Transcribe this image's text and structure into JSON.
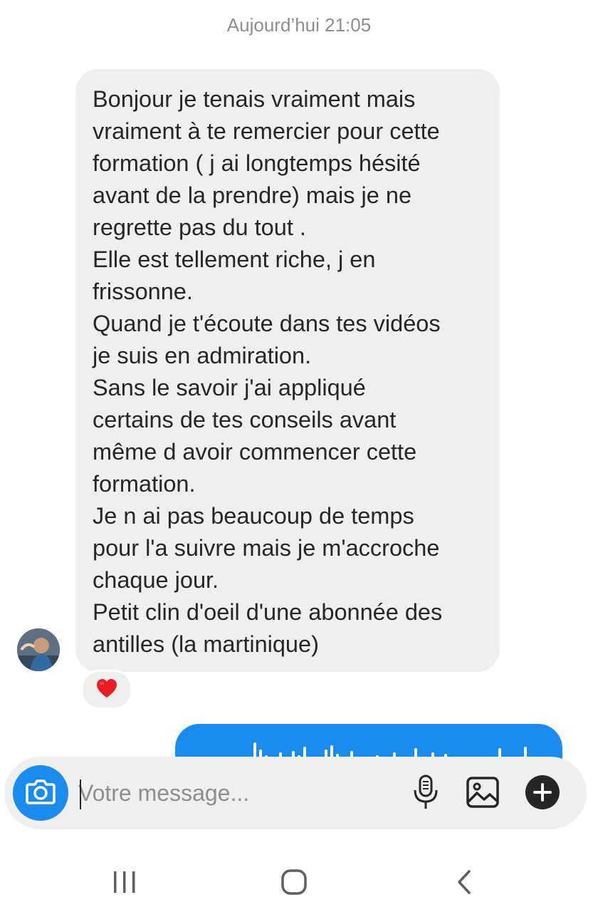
{
  "thread": {
    "timestamp": "Aujourd’hui 21:05"
  },
  "incoming_message": {
    "text": "Bonjour je tenais vraiment mais\nvraiment à te remercier pour cette\nformation ( j ai longtemps hésité\navant de la prendre) mais je ne\nregrette pas du tout .\nElle est tellement riche, j en\nfrissonne.\nQuand je t'écoute dans tes vidéos\nje suis en admiration.\nSans le savoir j'ai appliqué\ncertains de tes conseils avant\nmême d avoir commencer cette\nformation.\nJe n ai pas beaucoup de temps\npour l'a suivre mais je m'accroche\nchaque jour.\nPetit clin d'oeil d'une abonnée des\nantilles (la martinique)",
    "reaction": "heart"
  },
  "outgoing_message": {
    "type": "voice-note"
  },
  "composer": {
    "placeholder": "Votre message...",
    "value": "",
    "icons": [
      "camera-icon",
      "microphone-icon",
      "image-icon",
      "plus-icon"
    ]
  },
  "system_nav": {
    "buttons": [
      "recent-apps-icon",
      "home-icon",
      "back-icon"
    ]
  },
  "colors": {
    "accent": "#1a8cef",
    "bubble_in": "#efefef",
    "text": "#262626",
    "muted": "#8e8e8e",
    "heart": "#ed1c24"
  }
}
